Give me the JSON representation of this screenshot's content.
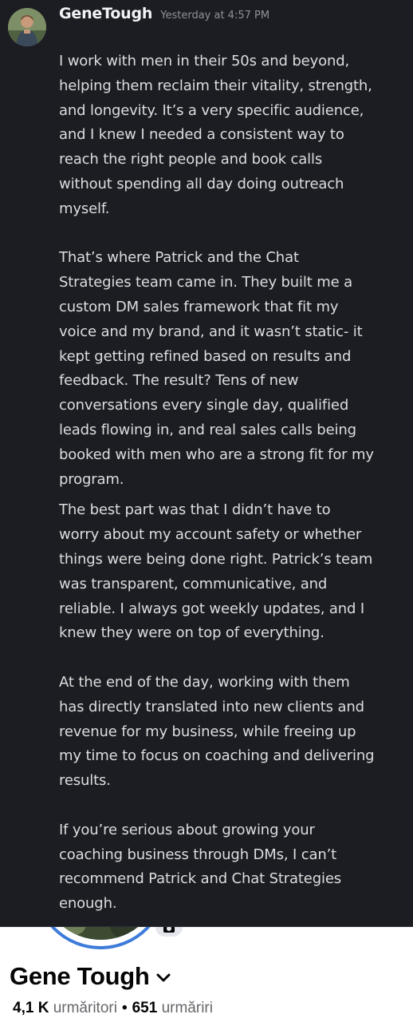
{
  "message": {
    "author": "GeneTough",
    "timestamp": "Yesterday at 4:57 PM",
    "lines": [
      "I work with men in their 50s and beyond,",
      "helping them reclaim their vitality, strength,",
      "and longevity. It’s a very specific audience,",
      "and I knew I needed a consistent way to",
      "reach the right people and book calls",
      "without spending all day doing outreach",
      "myself.",
      "",
      "That’s where Patrick and the Chat",
      "Strategies team came in. They built me a",
      "custom DM sales framework that fit my",
      "voice and my brand, and it wasn’t static- it",
      "kept getting refined based on results and",
      "feedback. The result? Tens of new",
      "conversations every single day, qualified",
      "leads flowing in, and real sales calls being",
      "booked with men who are a strong fit for my",
      "program.",
      "~",
      "The best part was that I didn’t have to",
      "worry about my account safety or whether",
      "things were being done right. Patrick’s team",
      "was transparent, communicative, and",
      "reliable. I always got weekly updates, and I",
      "knew they were on top of everything.",
      "",
      "At the end of the day, working with them",
      "has directly translated into new clients and",
      "revenue for my business, while freeing up",
      "my time to focus on coaching and delivering",
      "results.",
      "",
      "If you’re serious about growing your",
      "coaching business through DMs, I can’t",
      "recommend Patrick and Chat Strategies",
      "enough."
    ]
  },
  "profile": {
    "name": "Gene Tough",
    "followers_count": "4,1 K",
    "followers_label": "urmăritori",
    "separator": "•",
    "following_count": "651",
    "following_label": "urmăriri"
  },
  "icons": {
    "avatar": "user-avatar",
    "profile_chevron": "chevron-down-icon",
    "camera": "camera-icon"
  },
  "colors": {
    "chat_background": "#1c1d22",
    "username": "#f2f3f5",
    "timestamp": "#8e9297",
    "message_text": "#dcddde",
    "profile_ring": "#3d7bd9"
  }
}
